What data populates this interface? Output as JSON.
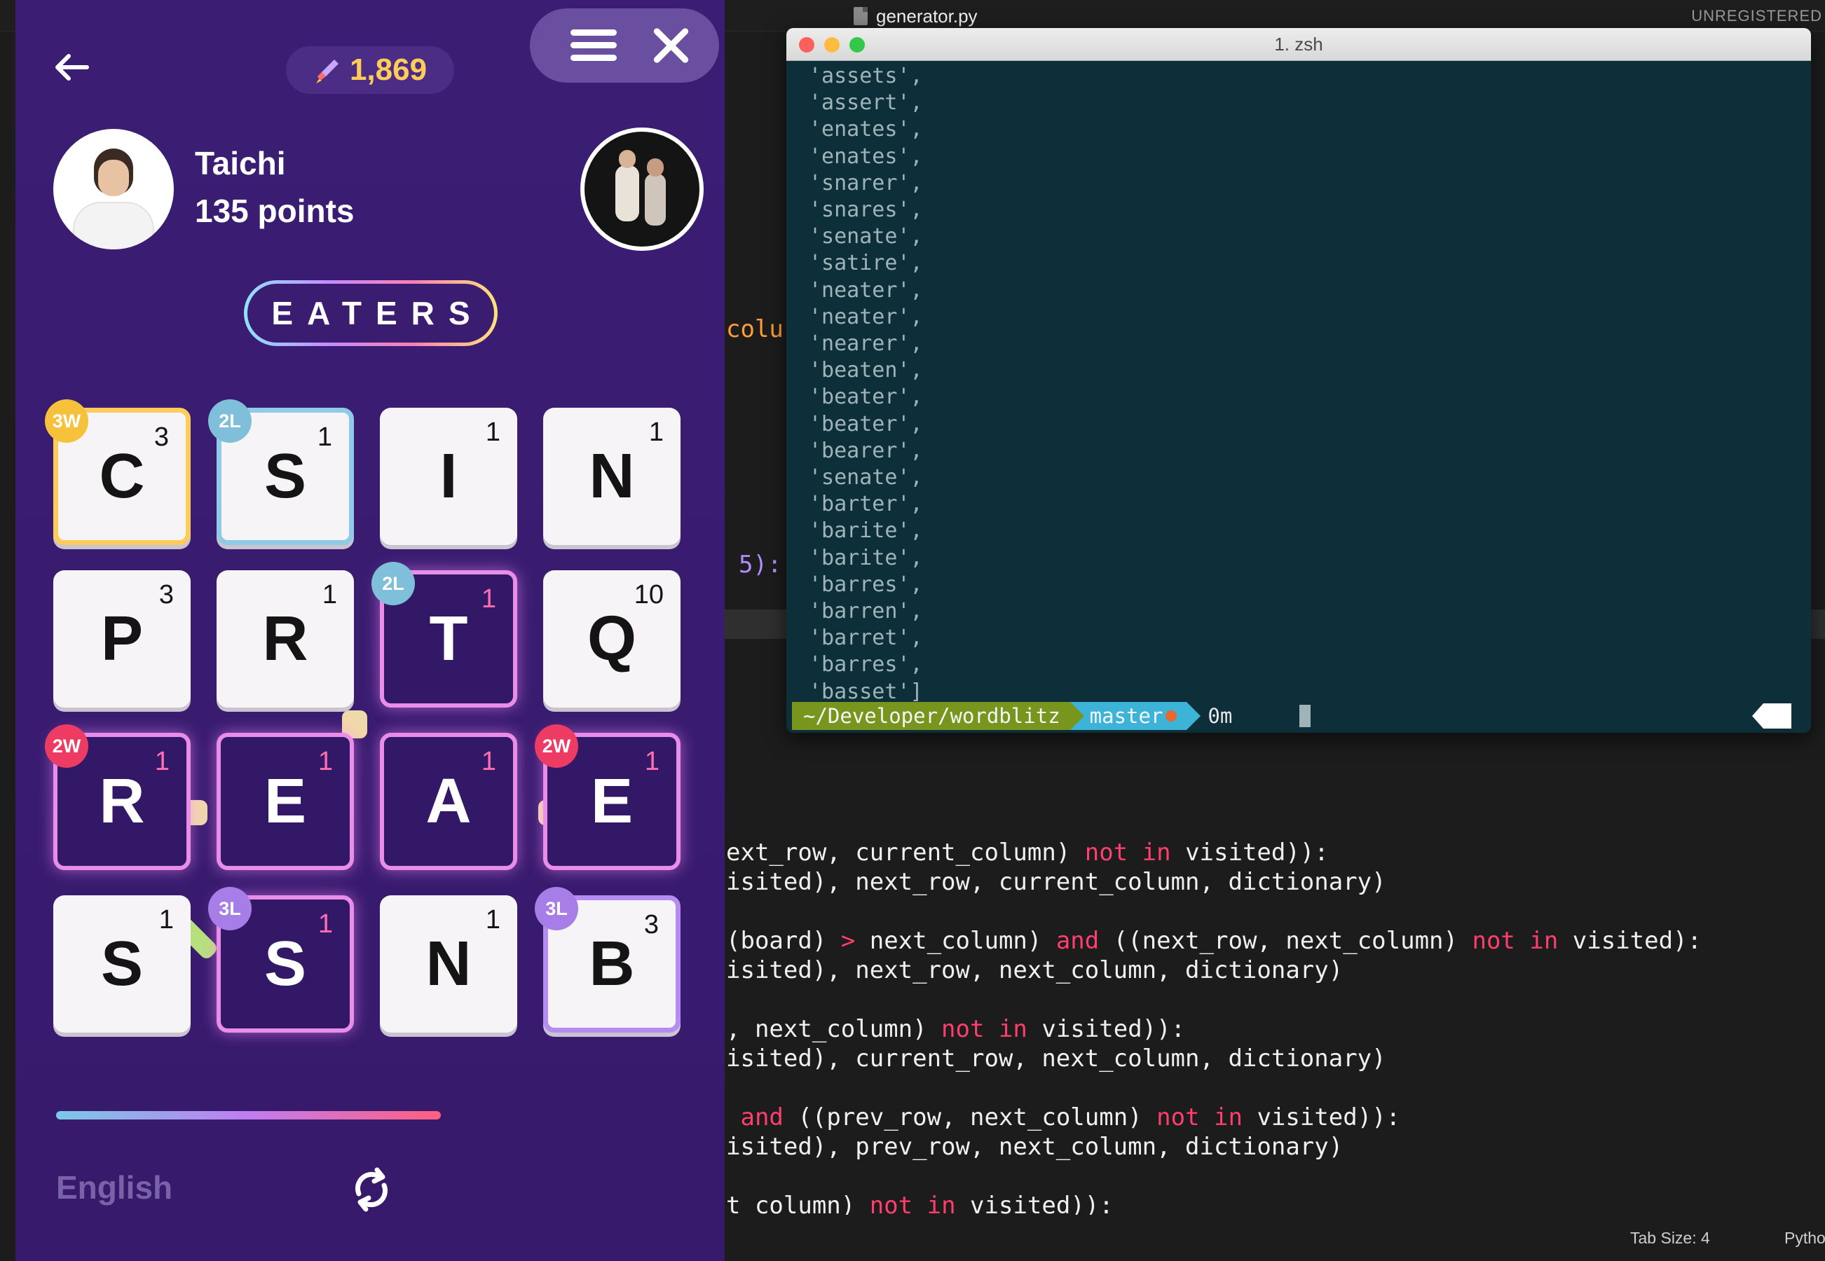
{
  "editor": {
    "file_tab": "generator.py",
    "unregistered": "UNREGISTERED",
    "snippet_colu": "colu",
    "snippet_5": "5):",
    "code_lines": [
      [
        {
          "t": "ext_row, current_column) "
        },
        {
          "t": "not",
          "k": 1
        },
        {
          "t": " "
        },
        {
          "t": "in",
          "k": 1
        },
        {
          "t": " visited)):"
        }
      ],
      [
        {
          "t": "isited), next_row, current_column, dictionary)"
        }
      ],
      [
        {
          "t": ""
        }
      ],
      [
        {
          "t": "(board) "
        },
        {
          "t": ">",
          "k": 1
        },
        {
          "t": " next_column) "
        },
        {
          "t": "and",
          "k": 1
        },
        {
          "t": " ((next_row, next_column) "
        },
        {
          "t": "not",
          "k": 1
        },
        {
          "t": " "
        },
        {
          "t": "in",
          "k": 1
        },
        {
          "t": " visited):"
        }
      ],
      [
        {
          "t": "isited), next_row, next_column, dictionary)"
        }
      ],
      [
        {
          "t": ""
        }
      ],
      [
        {
          "t": ", next_column) "
        },
        {
          "t": "not",
          "k": 1
        },
        {
          "t": " "
        },
        {
          "t": "in",
          "k": 1
        },
        {
          "t": " visited)):"
        }
      ],
      [
        {
          "t": "isited), current_row, next_column, dictionary)"
        }
      ],
      [
        {
          "t": ""
        }
      ],
      [
        {
          "t": " "
        },
        {
          "t": "and",
          "k": 1
        },
        {
          "t": " ((prev_row, next_column) "
        },
        {
          "t": "not",
          "k": 1
        },
        {
          "t": " "
        },
        {
          "t": "in",
          "k": 1
        },
        {
          "t": " visited)):"
        }
      ],
      [
        {
          "t": "isited), prev_row, next_column, dictionary)"
        }
      ],
      [
        {
          "t": ""
        }
      ],
      [
        {
          "t": "t_column) "
        },
        {
          "t": "not",
          "k": 1
        },
        {
          "t": " "
        },
        {
          "t": "in",
          "k": 1
        },
        {
          "t": " visited)):"
        }
      ]
    ],
    "status": {
      "tab_size": "Tab Size: 4",
      "language": "Python"
    }
  },
  "game": {
    "score": "1,869",
    "player": {
      "name": "Taichi",
      "points": "135 points"
    },
    "current_word": "EATERS",
    "language": "English",
    "icons": {
      "back": "back-arrow-icon",
      "score": "rocket-icon",
      "menu": "hamburger-menu-icon",
      "close": "close-icon",
      "refresh": "refresh-icon"
    },
    "colors": {
      "background": "#3a1c71",
      "score": "#ffcc57",
      "selected_tile": "#321866"
    },
    "tiles": [
      {
        "letter": "C",
        "pts": "3",
        "bonus": "3W",
        "selected": false
      },
      {
        "letter": "S",
        "pts": "1",
        "bonus": "2L",
        "selected": false
      },
      {
        "letter": "I",
        "pts": "1",
        "bonus": "",
        "selected": false
      },
      {
        "letter": "N",
        "pts": "1",
        "bonus": "",
        "selected": false
      },
      {
        "letter": "P",
        "pts": "3",
        "bonus": "",
        "selected": false
      },
      {
        "letter": "R",
        "pts": "1",
        "bonus": "",
        "selected": false
      },
      {
        "letter": "T",
        "pts": "1",
        "bonus": "2L",
        "selected": true
      },
      {
        "letter": "Q",
        "pts": "10",
        "bonus": "",
        "selected": false
      },
      {
        "letter": "R",
        "pts": "1",
        "bonus": "2W",
        "selected": true
      },
      {
        "letter": "E",
        "pts": "1",
        "bonus": "",
        "selected": true
      },
      {
        "letter": "A",
        "pts": "1",
        "bonus": "",
        "selected": true
      },
      {
        "letter": "E",
        "pts": "1",
        "bonus": "2W",
        "selected": true
      },
      {
        "letter": "S",
        "pts": "1",
        "bonus": "",
        "selected": false
      },
      {
        "letter": "S",
        "pts": "1",
        "bonus": "3L",
        "selected": true
      },
      {
        "letter": "N",
        "pts": "1",
        "bonus": "",
        "selected": false
      },
      {
        "letter": "B",
        "pts": "3",
        "bonus": "3L",
        "selected": false
      }
    ],
    "progress_fraction": 0.59
  },
  "terminal": {
    "title": "1. zsh",
    "lines": [
      "'assets',",
      "'assert',",
      "'enates',",
      "'enates',",
      "'snarer',",
      "'snares',",
      "'senate',",
      "'satire',",
      "'neater',",
      "'neater',",
      "'nearer',",
      "'beaten',",
      "'beater',",
      "'beater',",
      "'bearer',",
      "'senate',",
      "'barter',",
      "'barite',",
      "'barite',",
      "'barres',",
      "'barren',",
      "'barret',",
      "'barres',",
      "'basset']"
    ],
    "prompt": {
      "path": "~/Developer/wordblitz",
      "branch": "master",
      "time": "0m"
    }
  }
}
